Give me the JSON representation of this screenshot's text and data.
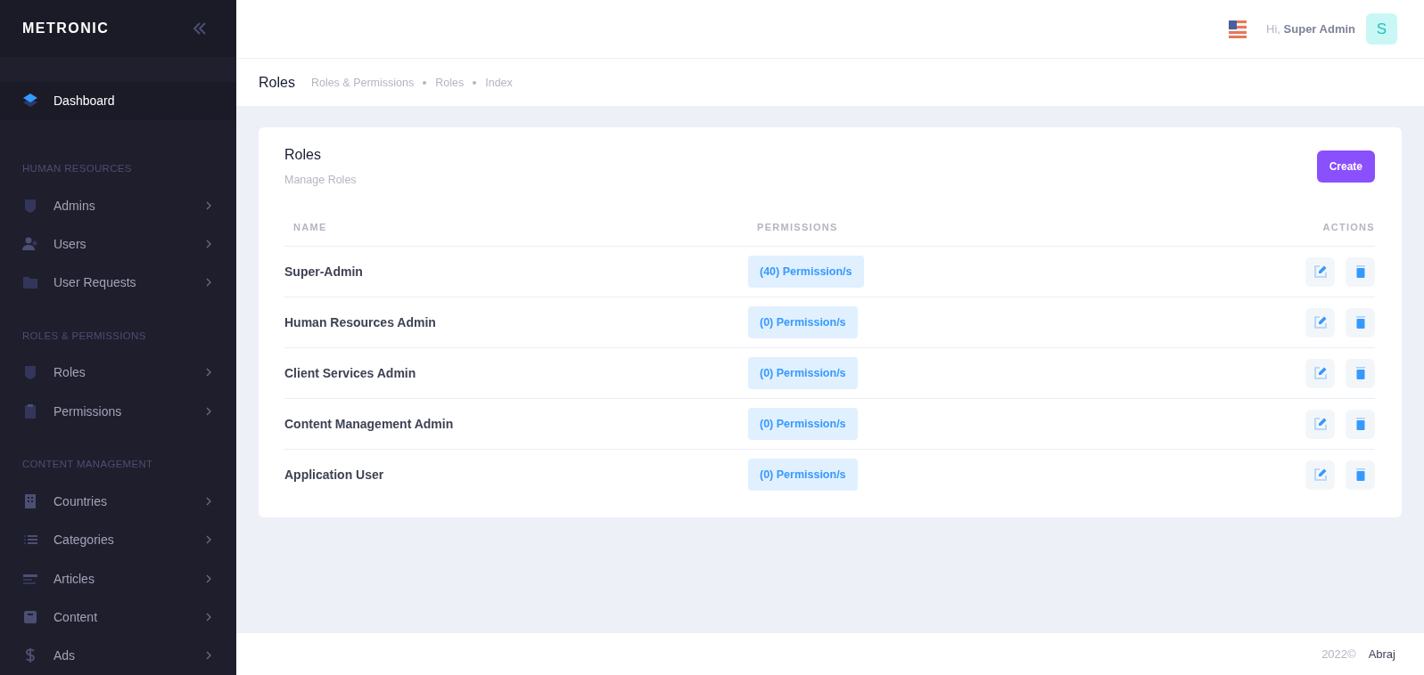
{
  "brand": "METRONIC",
  "sidebar": {
    "top": [
      {
        "label": "Dashboard",
        "selected": true
      }
    ],
    "sections": [
      {
        "title": "HUMAN RESOURCES",
        "items": [
          {
            "label": "Admins",
            "selected": false
          },
          {
            "label": "Users",
            "selected": false
          },
          {
            "label": "User Requests",
            "selected": false
          }
        ]
      },
      {
        "title": "ROLES & PERMISSIONS",
        "items": [
          {
            "label": "Roles",
            "selected": false
          },
          {
            "label": "Permissions",
            "selected": false
          }
        ]
      },
      {
        "title": "CONTENT MANAGEMENT",
        "items": [
          {
            "label": "Countries",
            "selected": false
          },
          {
            "label": "Categories",
            "selected": false
          },
          {
            "label": "Articles",
            "selected": false
          },
          {
            "label": "Content",
            "selected": false
          },
          {
            "label": "Ads",
            "selected": false
          }
        ]
      }
    ]
  },
  "header": {
    "greeting": "Hi,",
    "user": "Super Admin",
    "avatar": "S"
  },
  "subheader": {
    "title": "Roles",
    "breadcrumbs": [
      "Roles & Permissions",
      "Roles",
      "Index"
    ]
  },
  "card": {
    "title": "Roles",
    "subtitle": "Manage Roles",
    "create_button": "Create",
    "columns": [
      "NAME",
      "PERMISSIONS",
      "ACTIONS"
    ],
    "rows": [
      {
        "name": "Super-Admin",
        "permissions": "(40) Permission/s"
      },
      {
        "name": "Human Resources Admin",
        "permissions": "(0) Permission/s"
      },
      {
        "name": "Client Services Admin",
        "permissions": "(0) Permission/s"
      },
      {
        "name": "Content Management Admin",
        "permissions": "(0) Permission/s"
      },
      {
        "name": "Application User",
        "permissions": "(0) Permission/s"
      }
    ]
  },
  "footer": {
    "year": "2022©",
    "company": "Abraj"
  }
}
